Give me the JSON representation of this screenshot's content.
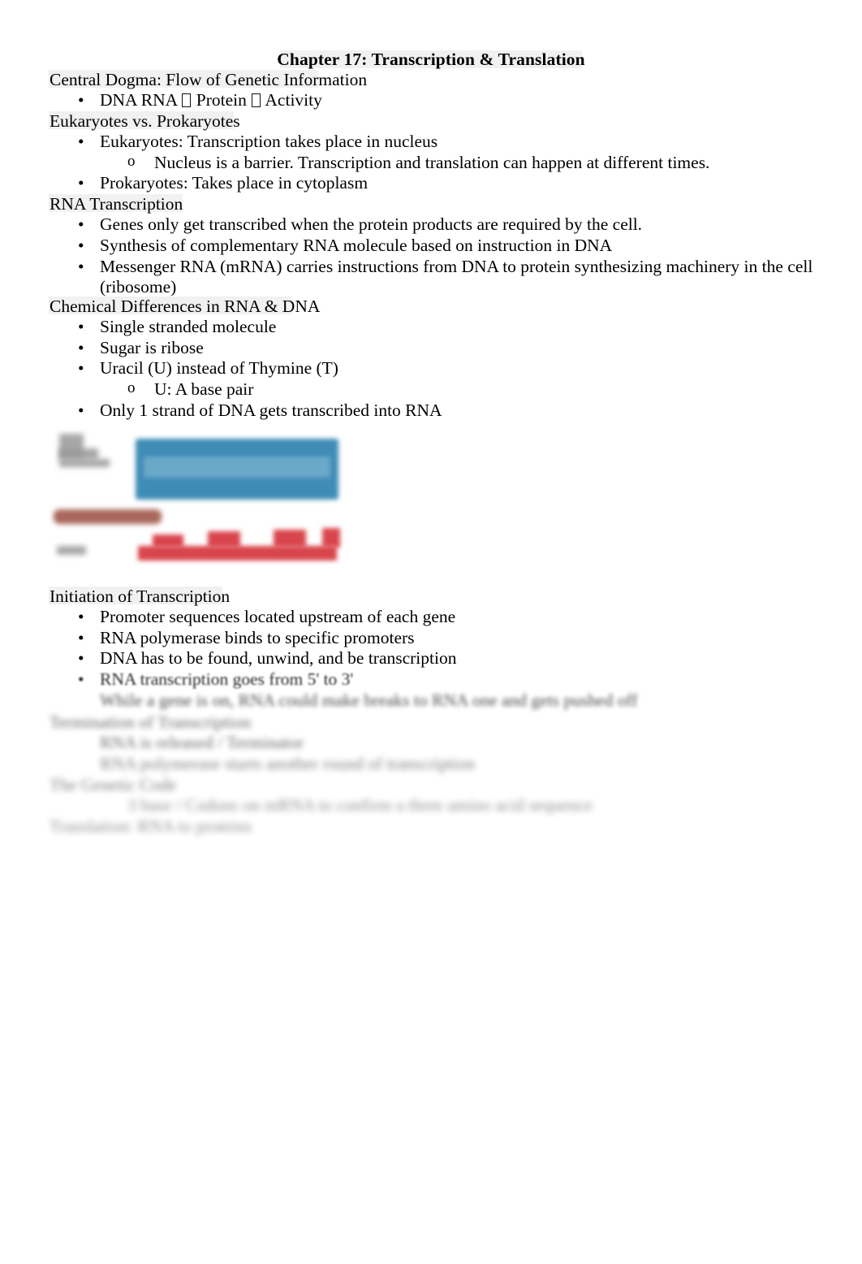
{
  "document": {
    "title": "Chapter 17: Transcription & Translation",
    "sections": [
      {
        "heading": "Central Dogma: Flow of Genetic Information",
        "bullets": [
          {
            "level": 1,
            "marker": "•",
            "text_before": "DNA RNA ",
            "text_mid": " Protein ",
            "text_after": " Activity",
            "has_glyph_boxes": true,
            "text": "DNA RNA ⎕ Protein ⎕ Activity"
          }
        ]
      },
      {
        "heading": "Eukaryotes vs. Prokaryotes",
        "bullets": [
          {
            "level": 1,
            "marker": "•",
            "text": "Eukaryotes: Transcription takes place in nucleus"
          },
          {
            "level": 2,
            "marker": "o",
            "text": "Nucleus is a barrier. Transcription and translation can happen at different times."
          },
          {
            "level": 1,
            "marker": "•",
            "text": "Prokaryotes: Takes place in cytoplasm"
          }
        ]
      },
      {
        "heading": "RNA Transcription",
        "bullets": [
          {
            "level": 1,
            "marker": "•",
            "text": "Genes only get transcribed when the protein products are required by the cell."
          },
          {
            "level": 1,
            "marker": "•",
            "text": "Synthesis of complementary RNA molecule based on instruction in DNA"
          },
          {
            "level": 1,
            "marker": "•",
            "text": "Messenger RNA (mRNA) carries instructions from DNA to protein synthesizing machinery in the cell"
          },
          {
            "level": 1,
            "marker": "",
            "text": "(ribosome)",
            "continuation": true
          }
        ]
      },
      {
        "heading": "Chemical Differences in RNA & DNA",
        "bullets": [
          {
            "level": 1,
            "marker": "•",
            "text": "Single stranded molecule"
          },
          {
            "level": 1,
            "marker": "•",
            "text": "Sugar is ribose"
          },
          {
            "level": 1,
            "marker": "•",
            "text": "Uracil (U) instead of Thymine (T)"
          },
          {
            "level": 2,
            "marker": "o",
            "text": "U: A base pair"
          },
          {
            "level": 1,
            "marker": "•",
            "text": "Only 1 strand of DNA gets transcribed into RNA"
          }
        ]
      },
      {
        "heading": "Initiation of Transcription",
        "bullets": [
          {
            "level": 1,
            "marker": "•",
            "text": "Promoter sequences located upstream of each gene"
          },
          {
            "level": 1,
            "marker": "•",
            "text": "RNA polymerase binds to specific promoters"
          },
          {
            "level": 1,
            "marker": "•",
            "text": "DNA has to be found, unwind, and be transcription"
          },
          {
            "level": 1,
            "marker": "•",
            "text": "RNA transcription goes from 5' to 3'",
            "blurred": true
          },
          {
            "level": 1,
            "marker": "",
            "text": "While a gene is on, RNA could make breaks to RNA one and gets pushed off",
            "continuation": true,
            "blurred": true
          }
        ]
      },
      {
        "heading": "Termination of Transcription",
        "blurred": true,
        "bullets": [
          {
            "level": 1,
            "marker": "",
            "text": "RNA is released / Terminator",
            "blurred": true
          },
          {
            "level": 1,
            "marker": "",
            "text": "RNA polymerase starts another round of transcription",
            "blurred": true
          }
        ]
      },
      {
        "heading": "The Genetic Code",
        "blurred": true,
        "bullets": [
          {
            "level": 1,
            "marker": "",
            "text": "3 base / Codons on mRNA to confirm a three amino acid sequence",
            "blurred": true
          }
        ]
      },
      {
        "heading": "Translation: RNA to proteins",
        "blurred": true,
        "bullets": []
      }
    ],
    "figure": {
      "name": "dna-rna-strand-diagram",
      "alt": "Blurred diagram of DNA template strand (blue) and RNA transcript (red)",
      "colors": {
        "blue_strand": "#3f8cb6",
        "blue_inner": "#6ba9c9",
        "red_strand": "#d9454c",
        "brown_bar": "#a9675b",
        "gray_label": "#9b9b9b"
      }
    }
  }
}
